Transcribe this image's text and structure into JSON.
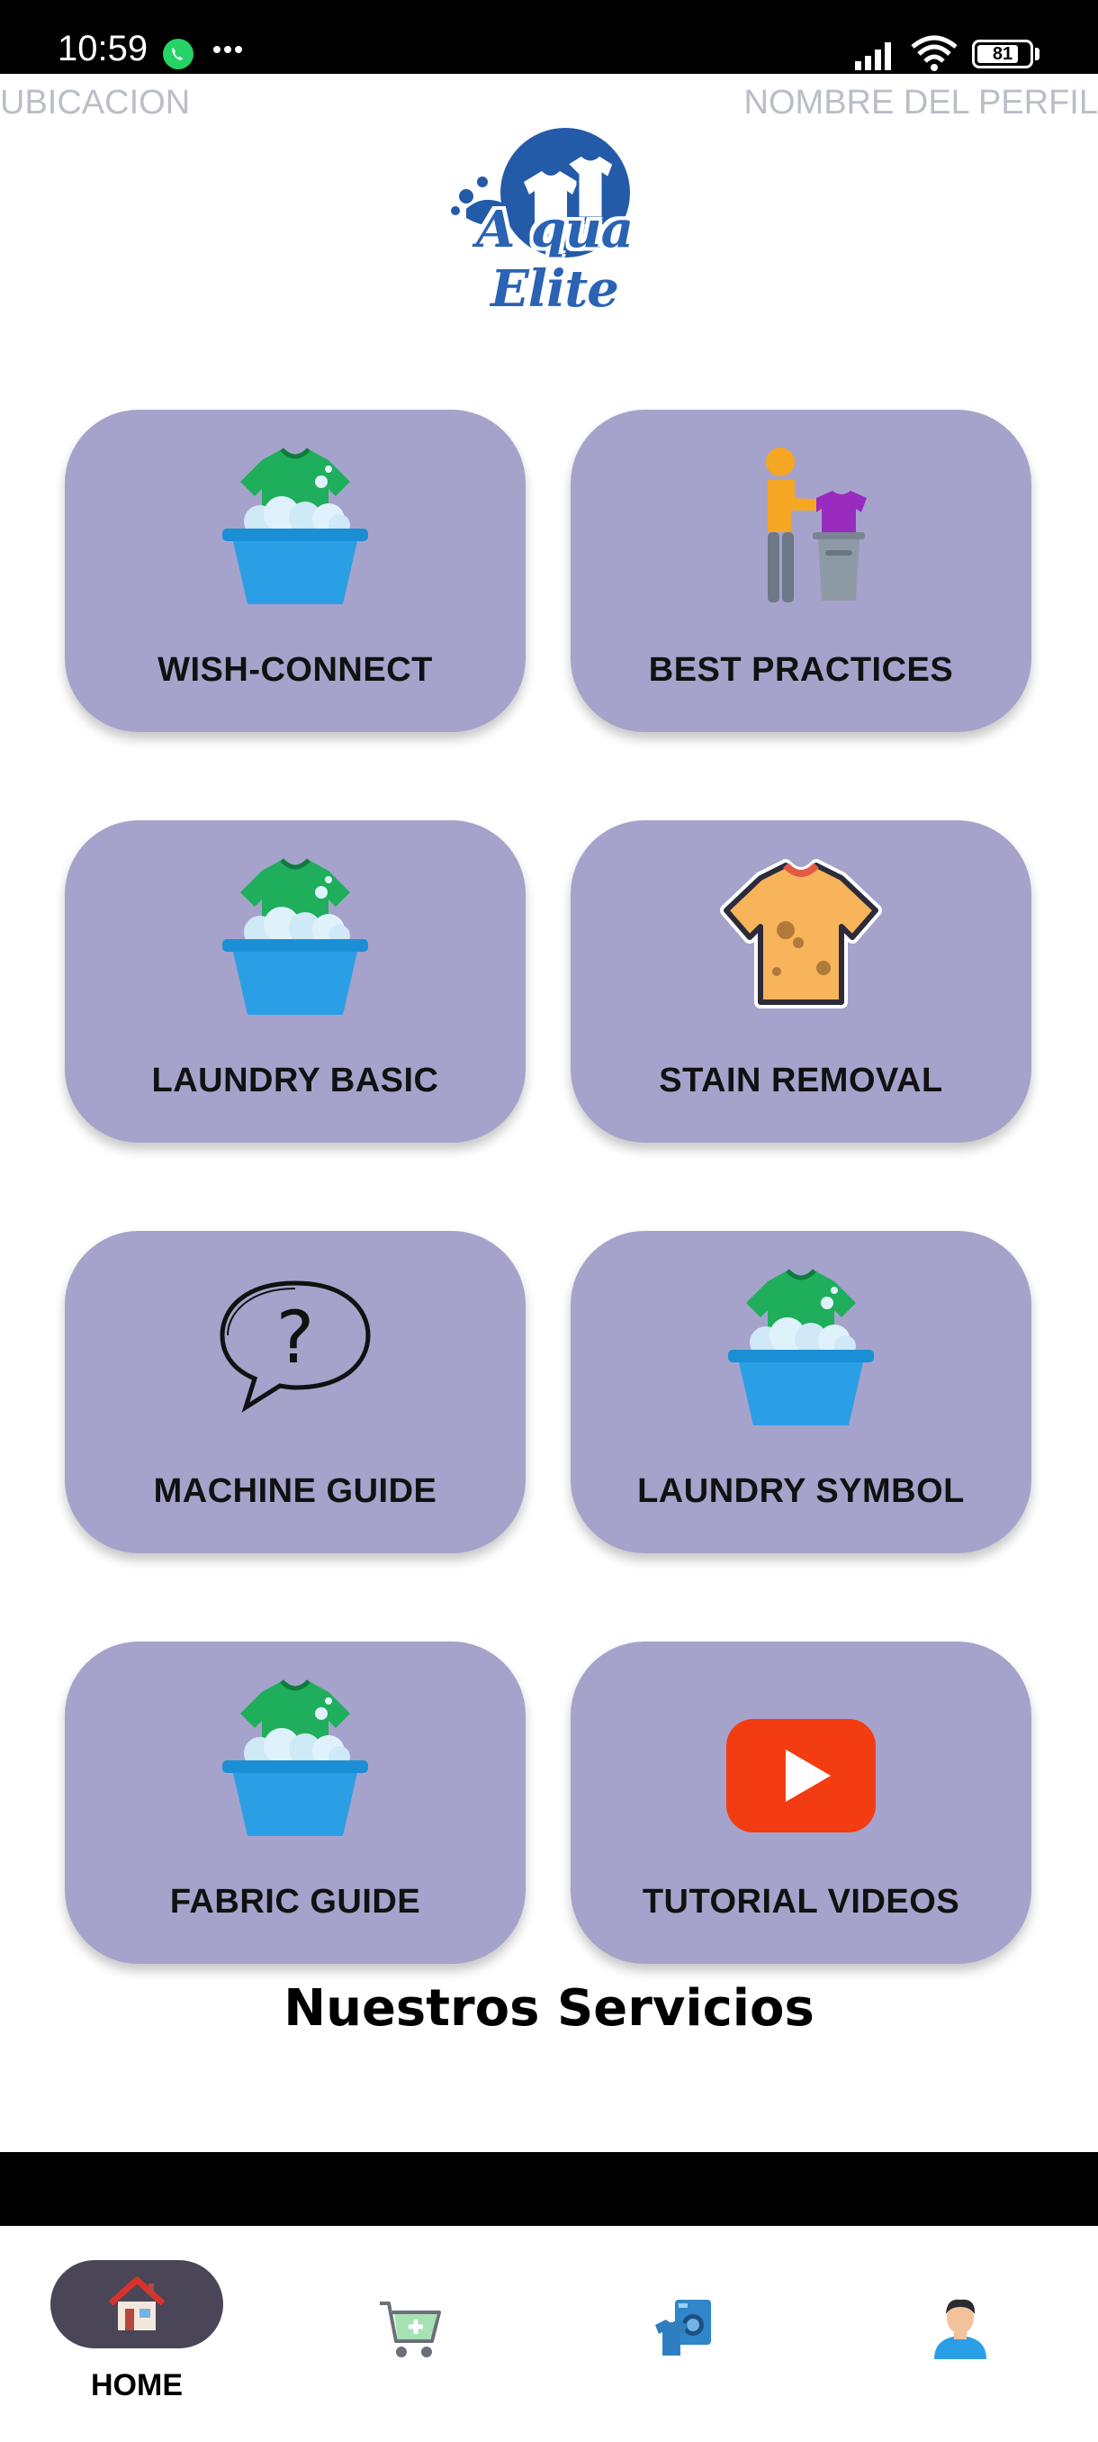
{
  "status_bar": {
    "time": "10:59",
    "battery": "81",
    "icons": [
      "whatsapp-icon",
      "more-dots-icon",
      "signal-icon",
      "wifi-icon",
      "battery-icon"
    ]
  },
  "header": {
    "location_label": "UBICACION",
    "profile_label": "NOMBRE DEL PERFIL",
    "logo_text": "A qua Elite"
  },
  "menu": {
    "items": [
      {
        "label": "WISH-CONNECT",
        "icon": "laundry-basin-icon"
      },
      {
        "label": "BEST PRACTICES",
        "icon": "person-folding-clothes-icon"
      },
      {
        "label": "LAUNDRY BASIC",
        "icon": "laundry-basin-icon"
      },
      {
        "label": "STAIN REMOVAL",
        "icon": "stained-shirt-icon"
      },
      {
        "label": "MACHINE GUIDE",
        "icon": "question-bubble-icon"
      },
      {
        "label": "LAUNDRY SYMBOL",
        "icon": "laundry-basin-icon"
      },
      {
        "label": "FABRIC GUIDE",
        "icon": "laundry-basin-icon"
      },
      {
        "label": "TUTORIAL VIDEOS",
        "icon": "youtube-play-icon"
      }
    ]
  },
  "section": {
    "title": "Nuestros Servicios"
  },
  "bottom_nav": {
    "home_label": "HOME",
    "items": [
      "home-icon",
      "cart-add-icon",
      "washing-service-icon",
      "user-avatar-icon"
    ]
  },
  "colors": {
    "card_bg": "#a5a3cb",
    "nav_active_bg": "#4a4557",
    "logo_blue": "#2a62b4",
    "status_bar_bg": "#000000"
  }
}
